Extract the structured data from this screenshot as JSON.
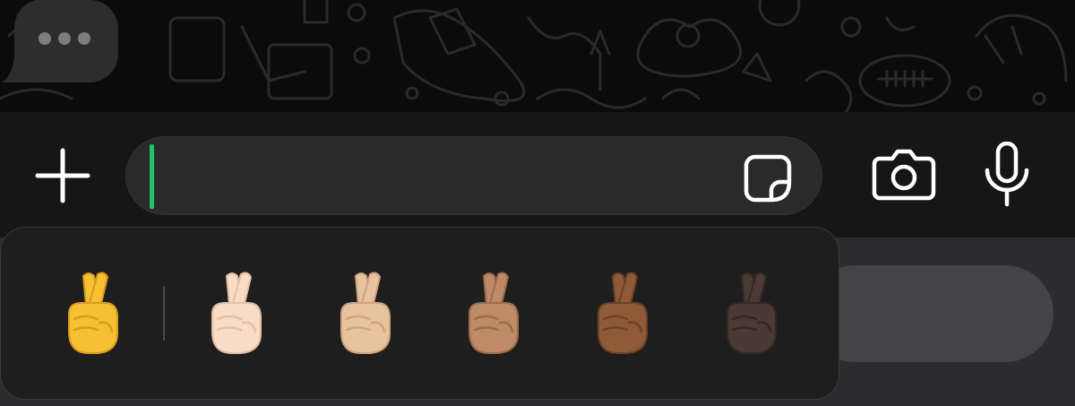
{
  "chat": {
    "typing_indicator": "typing-dots-icon"
  },
  "composer": {
    "plus_icon": "plus-icon",
    "message_text": "",
    "sticker_icon": "sticker-icon",
    "camera_icon": "camera-icon",
    "mic_icon": "microphone-icon",
    "caret_color": "#25c16f"
  },
  "skin_tone_picker": {
    "emoji_name": "crossed-fingers",
    "tones": [
      {
        "id": "default",
        "color": "#f5c033",
        "shade": "#d99c1c"
      },
      {
        "id": "light",
        "color": "#f8dcc5",
        "shade": "#e4bfa4"
      },
      {
        "id": "medium-light",
        "color": "#e7c3a0",
        "shade": "#cfa47e"
      },
      {
        "id": "medium",
        "color": "#be8a67",
        "shade": "#9c6c4b"
      },
      {
        "id": "medium-dark",
        "color": "#8e5a37",
        "shade": "#6e4226"
      },
      {
        "id": "dark",
        "color": "#4a3a33",
        "shade": "#342822"
      }
    ]
  },
  "colors": {
    "chat_background": "#0b0b0b",
    "composer_background": "#161616",
    "field_background": "#2a2a2a",
    "picker_background": "#1e1e1f"
  }
}
